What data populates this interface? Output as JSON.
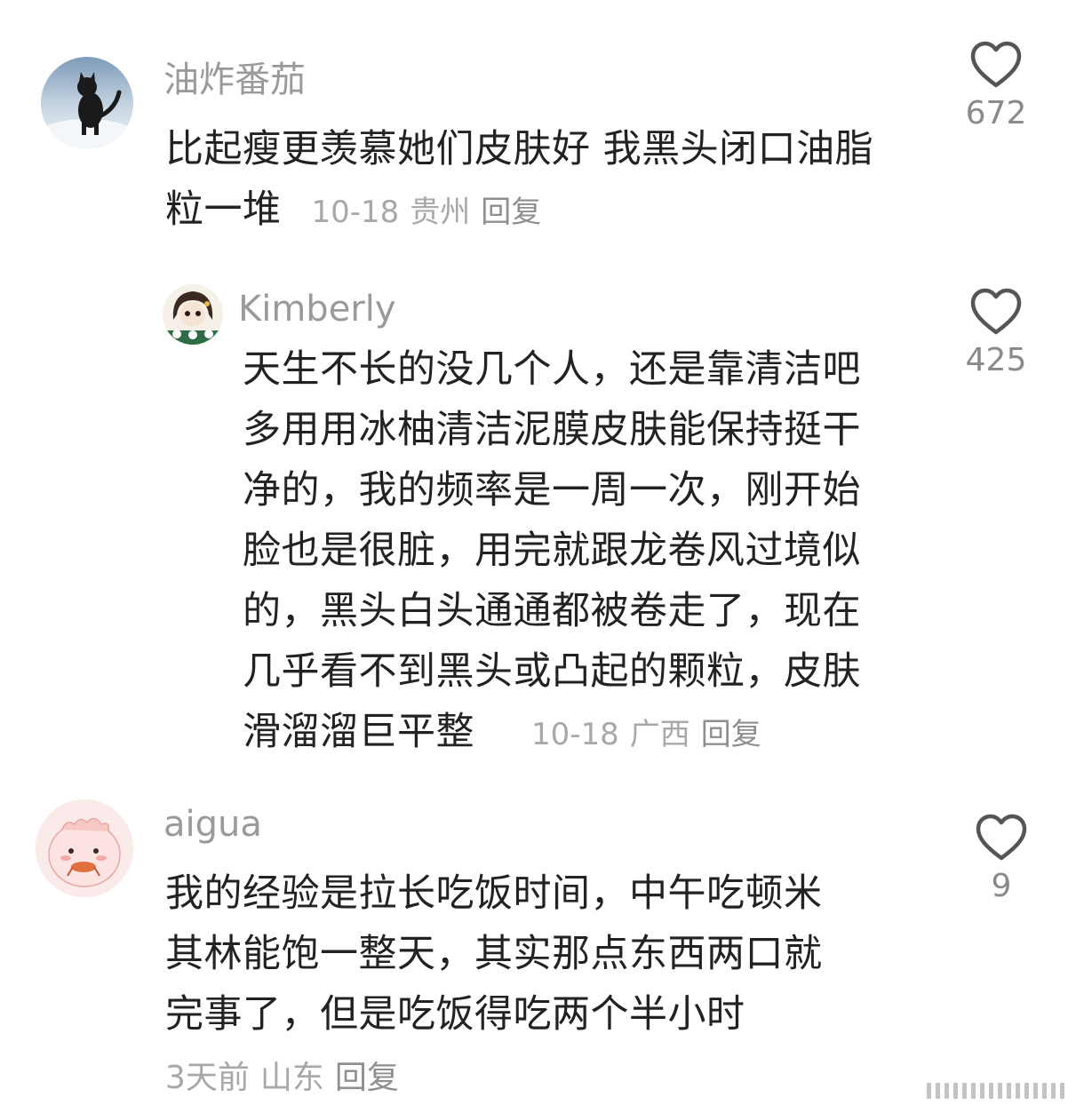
{
  "comments": [
    {
      "username": "油炸番茄",
      "text_line1": "比起瘦更羡慕她们皮肤好 我黑头闭口油脂",
      "text_line2": "粒一堆",
      "date": "10-18",
      "location": "贵州",
      "reply_label": "回复",
      "likes": "672"
    },
    {
      "username": "Kimberly",
      "text_lines": [
        "天生不长的没几个人，还是靠清洁吧",
        "多用用冰柚清洁泥膜皮肤能保持挺干",
        "净的，我的频率是一周一次，刚开始",
        "脸也是很脏，用完就跟龙卷风过境似",
        "的，黑头白头通通都被卷走了，现在",
        "几乎看不到黑头或凸起的颗粒，皮肤",
        "滑溜溜巨平整"
      ],
      "date": "10-18",
      "location": "广西",
      "reply_label": "回复",
      "likes": "425"
    },
    {
      "username": "aigua",
      "text_lines": [
        "我的经验是拉长吃饭时间，中午吃顿米",
        "其林能饱一整天，其实那点东西两口就",
        "完事了，但是吃饭得吃两个半小时"
      ],
      "date": "3天前",
      "location": "山东",
      "reply_label": "回复",
      "likes": "9"
    }
  ],
  "icons": {
    "like": "heart-outline-icon",
    "avatar1": "black-cat-in-snow",
    "avatar2": "cartoon-girl",
    "avatar3": "pink-creature-eating"
  },
  "colors": {
    "text": "#222222",
    "username": "#9a9a9a",
    "meta": "#a8a8a8",
    "heart": "#555555"
  }
}
